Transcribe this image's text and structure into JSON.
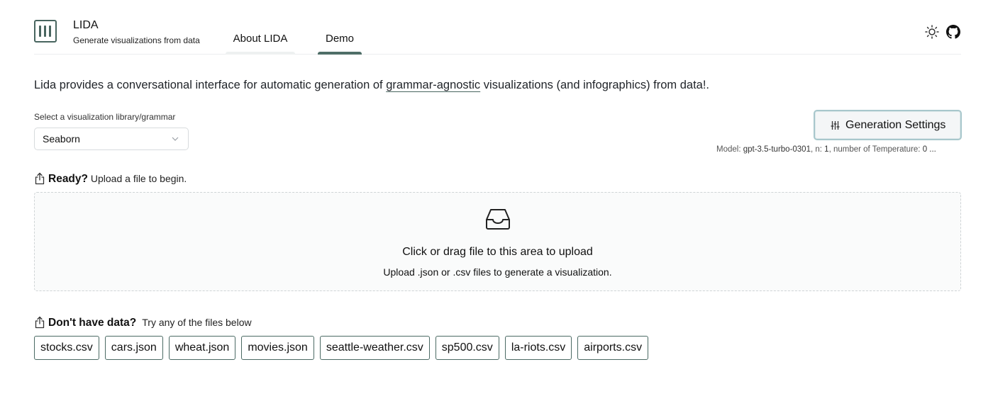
{
  "header": {
    "app_title": "LIDA",
    "app_subtitle": "Generate visualizations from data",
    "tabs": [
      {
        "label": "About LIDA",
        "active": false
      },
      {
        "label": "Demo",
        "active": true
      }
    ],
    "icons": [
      "logo-bars-icon",
      "sun-icon",
      "github-icon"
    ]
  },
  "intro": {
    "before": "Lida provides a conversational interface for automatic generation of ",
    "link": "grammar-agnostic",
    "after": " visualizations (and infographics) from data!."
  },
  "library_select": {
    "label": "Select a visualization library/grammar",
    "value": "Seaborn"
  },
  "generation": {
    "button_label": "Generation Settings",
    "model_prefix": "Model: ",
    "model_value": "gpt-3.5-turbo-0301",
    "n_prefix": ", n: ",
    "n_value": "1",
    "temp_prefix": ", number of Temperature: ",
    "temp_value": "0 ..."
  },
  "upload": {
    "ready_strong": "Ready?",
    "ready_text": " Upload a file to begin.",
    "dropzone_main": "Click or drag file to this area to upload",
    "dropzone_sub": "Upload .json or .csv files to generate a visualization."
  },
  "samples": {
    "strong": "Don't have data?",
    "text": "Try any of the files below",
    "files": [
      "stocks.csv",
      "cars.json",
      "wheat.json",
      "movies.json",
      "seattle-weather.csv",
      "sp500.csv",
      "la-riots.csv",
      "airports.csv"
    ]
  },
  "colors": {
    "accent": "#48655f",
    "button_border": "#a8c7cc",
    "divider": "#eceeef"
  }
}
